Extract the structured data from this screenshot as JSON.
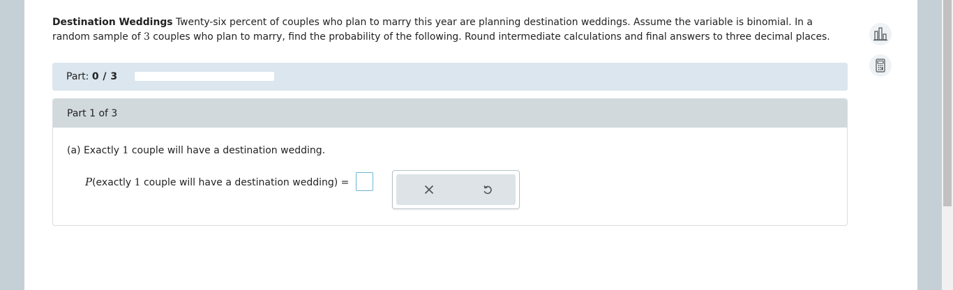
{
  "question": {
    "title": "Destination Weddings",
    "text_a": " Twenty-six percent of couples who plan to marry this year are planning destination weddings. Assume the variable is binomial. In a random sample of ",
    "sample_size": "3",
    "text_b": " couples who plan to marry, find the probability of the following. Round intermediate calculations and final answers to three decimal places."
  },
  "progress": {
    "label": "Part:",
    "value": "0 / 3",
    "fraction": 0
  },
  "part": {
    "header": "Part 1 of 3",
    "prompt_prefix": "(a) Exactly ",
    "prompt_number": "1",
    "prompt_suffix": " couple will have a destination wedding.",
    "eq_P": "P",
    "eq_open": "(exactly ",
    "eq_number": "1",
    "eq_rest": " couple will have a destination wedding)",
    "eq_equals": "=",
    "answer_value": ""
  },
  "tools": {
    "clear_icon": "close-icon",
    "undo_icon": "undo-icon"
  },
  "side_icons": [
    "bar-chart-icon",
    "calculator-icon"
  ],
  "colors": {
    "accent": "#4a78a8",
    "part_bar": "#dbe6ee",
    "card_header": "#d2d9dd",
    "input_border": "#6fb3d6"
  }
}
